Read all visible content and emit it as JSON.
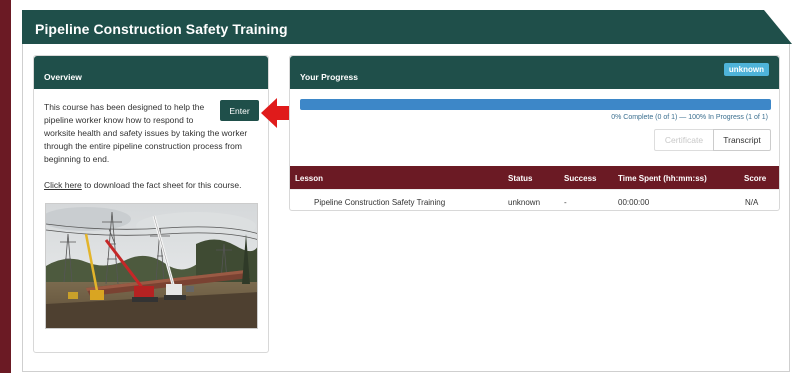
{
  "page": {
    "title": "Pipeline Construction Safety Training"
  },
  "overview": {
    "title": "Overview",
    "description_lines": [
      "This course has been designed to help the",
      "pipeline worker know how to respond to",
      "worksite health and safety issues by taking the worker",
      "through the entire pipeline construction process from",
      "beginning to end."
    ],
    "enter_label": "Enter",
    "fact_sheet_link": "Click here",
    "fact_sheet_text": " to download the fact sheet for this course."
  },
  "progress": {
    "title": "Your Progress",
    "badge": "unknown",
    "fill_fraction": 1.0,
    "summary": "0% Complete (0 of 1)  —  100% In Progress (1 of 1)",
    "certificate_label": "Certificate",
    "transcript_label": "Transcript"
  },
  "table": {
    "headers": [
      "Lesson",
      "Status",
      "Success",
      "Time Spent (hh:mm:ss)",
      "Score"
    ],
    "rows": [
      [
        "Pipeline Construction Safety Training",
        "unknown",
        "-",
        "00:00:00",
        "N/A"
      ]
    ]
  },
  "colors": {
    "teal": "#1f4f4a",
    "maroon": "#6b1a24",
    "progress_blue": "#3d87c8",
    "badge_blue": "#4eb3d9",
    "arrow_red": "#e01b1b"
  }
}
